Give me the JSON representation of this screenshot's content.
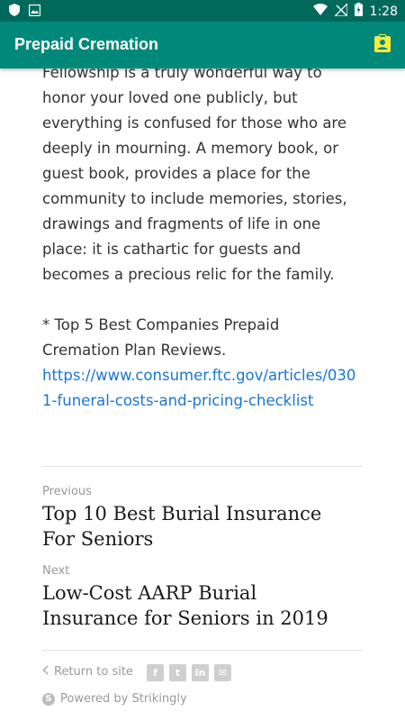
{
  "status_bar": {
    "time": "1:28"
  },
  "app_bar": {
    "title": "Prepaid Cremation",
    "action_icon": "contact-card-icon",
    "action_color": "#ffeb3b"
  },
  "article": {
    "paragraph1": "Fellowship is a truly wonderful way to honor your loved one publicly, but everything is confused for those who are deeply in mourning. A memory book, or guest book, provides a place for the community to include memories, stories, drawings and fragments of life in one place: it is cathartic for guests and becomes a precious relic for the family.",
    "paragraph2": "* Top 5 Best Companies Prepaid Cremation Plan Reviews.",
    "link": "https://www.consumer.ftc.gov/articles/0301-funeral-costs-and-pricing-checklist"
  },
  "post_nav": {
    "previous_label": "Previous",
    "previous_title": "Top 10 Best Burial Insurance For Seniors",
    "next_label": "Next",
    "next_title": "Low-Cost AARP Burial Insurance for Seniors in 2019"
  },
  "footer": {
    "return_label": "Return to site",
    "socials": [
      {
        "icon": "facebook-icon",
        "glyph": "f"
      },
      {
        "icon": "twitter-icon",
        "glyph": "t"
      },
      {
        "icon": "linkedin-icon",
        "glyph": "in"
      },
      {
        "icon": "email-icon",
        "glyph": "✉"
      }
    ],
    "powered_by": "Powered by Strikingly",
    "powered_logo_glyph": "S"
  },
  "colors": {
    "status_bar": "#00695c",
    "app_bar": "#00897b",
    "link": "#1976d2"
  }
}
